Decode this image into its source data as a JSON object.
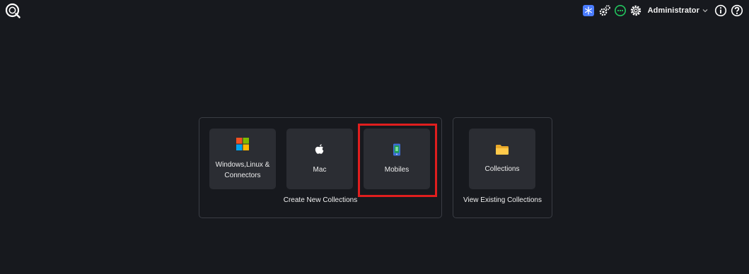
{
  "topbar": {
    "user_name": "Administrator",
    "accent_color": "#4a7cff",
    "status_color": "#22c55e",
    "icons": [
      "app-logo-icon",
      "snowflake-icon",
      "cogs-icon",
      "status-dots-icon",
      "settings-gear-icon",
      "chevron-down-icon",
      "info-icon",
      "help-icon"
    ]
  },
  "create_panel": {
    "caption": "Create New Collections",
    "cards": [
      {
        "label_line1": "Windows,Linux &",
        "label_line2": "Connectors",
        "icon": "windows-icon"
      },
      {
        "label": "Mac",
        "icon": "apple-icon"
      },
      {
        "label": "Mobiles",
        "icon": "mobile-phone-icon"
      }
    ]
  },
  "view_panel": {
    "caption": "View Existing Collections",
    "cards": [
      {
        "label": "Collections",
        "icon": "folder-icon"
      }
    ]
  },
  "highlight": {
    "target": "Mobiles",
    "color": "#e01e1e"
  }
}
